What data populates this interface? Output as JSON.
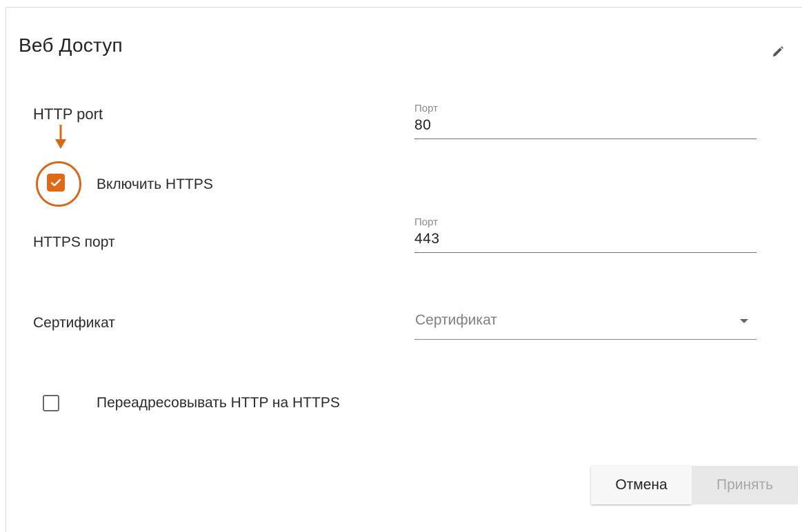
{
  "dialog": {
    "title": "Веб Доступ",
    "edit_icon": "pencil-icon"
  },
  "http": {
    "label": "HTTP port",
    "field_label": "Порт",
    "value": "80"
  },
  "https_toggle": {
    "label": "Включить HTTPS",
    "checked": true
  },
  "https": {
    "label": "HTTPS порт",
    "field_label": "Порт",
    "value": "443"
  },
  "certificate": {
    "label": "Сертификат",
    "placeholder": "Сертификат"
  },
  "redirect": {
    "label": "Переадресовывать HTTP на HTTPS",
    "checked": false
  },
  "actions": {
    "cancel_label": "Отмена",
    "apply_label": "Принять"
  },
  "colors": {
    "accent": "#dd6a19",
    "annotation": "#d6681d"
  }
}
